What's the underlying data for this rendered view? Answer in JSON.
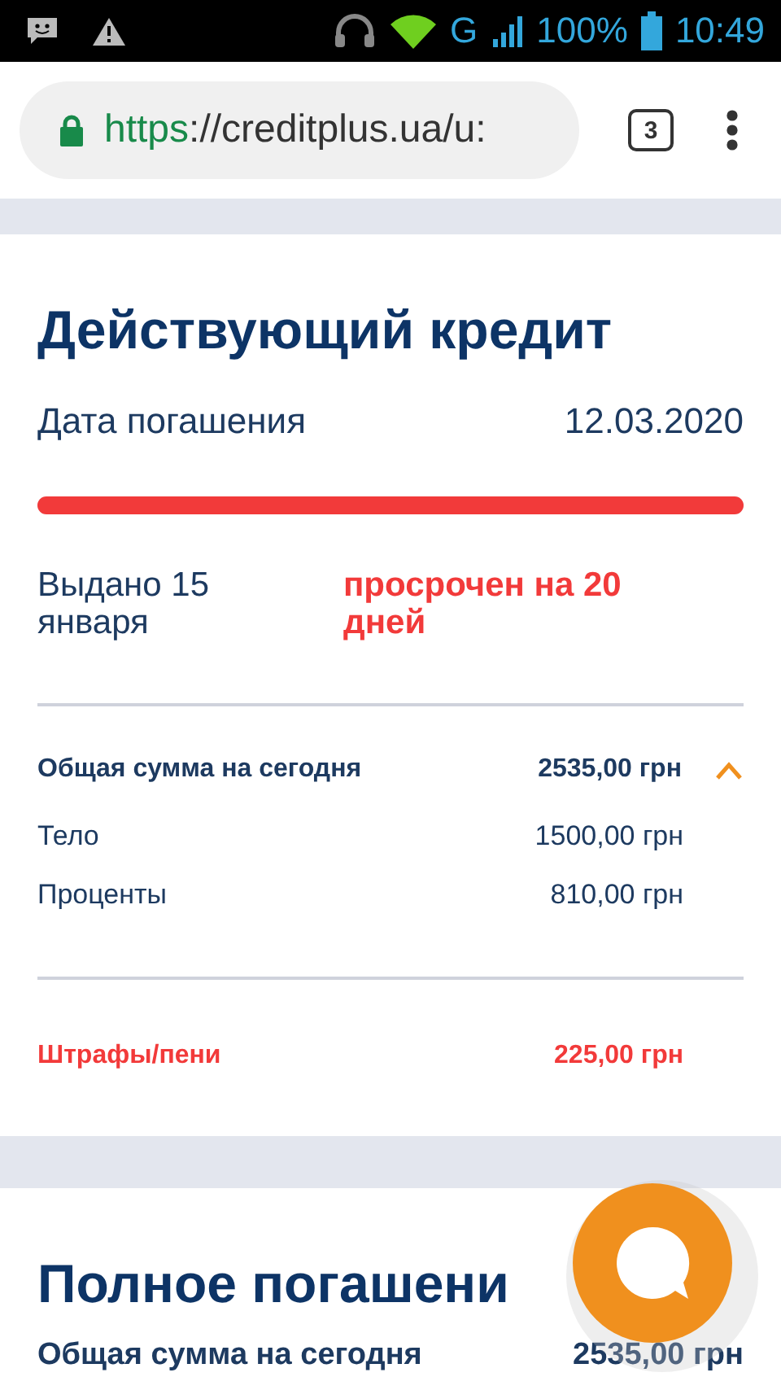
{
  "status_bar": {
    "network": "G",
    "battery": "100%",
    "time": "10:49"
  },
  "browser": {
    "url_scheme": "https",
    "url_rest": "://creditplus.ua/u:",
    "tab_count": "3"
  },
  "credit": {
    "title": "Действующий кредит",
    "due_label": "Дата погашения",
    "due_date": "12.03.2020",
    "overdue": true,
    "level": 1,
    "issued": "Выдано 15 января",
    "status": "просрочен на 20 дней",
    "total": {
      "label": "Общая сумма на сегодня",
      "value": "2535,00 грн",
      "expanded": true
    },
    "items": [
      {
        "label": "Тело",
        "value": "1500,00 грн"
      },
      {
        "label": "Проценты",
        "value": "810,00 грн"
      }
    ],
    "penalty": {
      "label": "Штрафы/пени",
      "value": "225,00 грн"
    }
  },
  "full": {
    "title": "Полное погашени",
    "total_label": "Общая сумма на сегодня",
    "total_value": "2535,00 грн"
  }
}
